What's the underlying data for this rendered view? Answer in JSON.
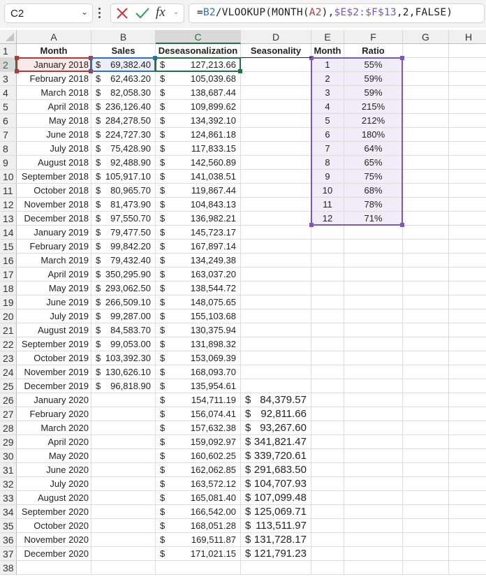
{
  "formula_bar": {
    "name_box": "C2",
    "formula_parts": [
      {
        "text": "=",
        "color": "default"
      },
      {
        "text": "B2",
        "color": "blue"
      },
      {
        "text": "/VLOOKUP(MONTH(",
        "color": "default"
      },
      {
        "text": "A2",
        "color": "red"
      },
      {
        "text": "),",
        "color": "default"
      },
      {
        "text": "$E$2:$F$13",
        "color": "purple"
      },
      {
        "text": ",2,FALSE)",
        "color": "default"
      }
    ],
    "cancel_icon": "x-icon",
    "enter_icon": "check-icon",
    "function_icon": "fx"
  },
  "colors": {
    "accent_green": "#217346",
    "ref_red": "#b03a3a",
    "ref_blue": "#2f6fc4",
    "ref_purple": "#7d56b8"
  },
  "sheet": {
    "active_cell": "C2",
    "columns": [
      "A",
      "B",
      "C",
      "D",
      "E",
      "F",
      "G",
      "H"
    ],
    "headers": {
      "A": "Month",
      "B": "Sales",
      "C": "Deseasonalization",
      "D": "Seasonality",
      "E": "Month",
      "F": "Ratio"
    },
    "rows": [
      {
        "month": "January 2018",
        "sales": "69,382.40",
        "deseason": "127,213.66",
        "seasonality": ""
      },
      {
        "month": "February 2018",
        "sales": "62,463.20",
        "deseason": "105,039.68",
        "seasonality": ""
      },
      {
        "month": "March 2018",
        "sales": "82,058.30",
        "deseason": "138,687.44",
        "seasonality": ""
      },
      {
        "month": "April 2018",
        "sales": "236,126.40",
        "deseason": "109,899.62",
        "seasonality": ""
      },
      {
        "month": "May 2018",
        "sales": "284,278.50",
        "deseason": "134,392.10",
        "seasonality": ""
      },
      {
        "month": "June 2018",
        "sales": "224,727.30",
        "deseason": "124,861.18",
        "seasonality": ""
      },
      {
        "month": "July 2018",
        "sales": "75,428.90",
        "deseason": "117,833.15",
        "seasonality": ""
      },
      {
        "month": "August 2018",
        "sales": "92,488.90",
        "deseason": "142,560.89",
        "seasonality": ""
      },
      {
        "month": "September 2018",
        "sales": "105,917.10",
        "deseason": "141,038.51",
        "seasonality": ""
      },
      {
        "month": "October 2018",
        "sales": "80,965.70",
        "deseason": "119,867.44",
        "seasonality": ""
      },
      {
        "month": "November 2018",
        "sales": "81,473.90",
        "deseason": "104,843.13",
        "seasonality": ""
      },
      {
        "month": "December 2018",
        "sales": "97,550.70",
        "deseason": "136,982.21",
        "seasonality": ""
      },
      {
        "month": "January 2019",
        "sales": "79,477.50",
        "deseason": "145,723.17",
        "seasonality": ""
      },
      {
        "month": "February 2019",
        "sales": "99,842.20",
        "deseason": "167,897.14",
        "seasonality": ""
      },
      {
        "month": "March 2019",
        "sales": "79,432.40",
        "deseason": "134,249.38",
        "seasonality": ""
      },
      {
        "month": "April 2019",
        "sales": "350,295.90",
        "deseason": "163,037.20",
        "seasonality": ""
      },
      {
        "month": "May 2019",
        "sales": "293,062.50",
        "deseason": "138,544.72",
        "seasonality": ""
      },
      {
        "month": "June 2019",
        "sales": "266,509.10",
        "deseason": "148,075.65",
        "seasonality": ""
      },
      {
        "month": "July 2019",
        "sales": "99,287.00",
        "deseason": "155,103.68",
        "seasonality": ""
      },
      {
        "month": "August 2019",
        "sales": "84,583.70",
        "deseason": "130,375.94",
        "seasonality": ""
      },
      {
        "month": "September 2019",
        "sales": "99,053.00",
        "deseason": "131,898.32",
        "seasonality": ""
      },
      {
        "month": "October 2019",
        "sales": "103,392.30",
        "deseason": "153,069.39",
        "seasonality": ""
      },
      {
        "month": "November 2019",
        "sales": "130,626.10",
        "deseason": "168,093.70",
        "seasonality": ""
      },
      {
        "month": "December 2019",
        "sales": "96,818.90",
        "deseason": "135,954.61",
        "seasonality": ""
      },
      {
        "month": "January 2020",
        "sales": "",
        "deseason": "154,711.19",
        "seasonality": "84,379.57"
      },
      {
        "month": "February 2020",
        "sales": "",
        "deseason": "156,074.41",
        "seasonality": "92,811.66"
      },
      {
        "month": "March 2020",
        "sales": "",
        "deseason": "157,632.38",
        "seasonality": "93,267.60"
      },
      {
        "month": "April 2020",
        "sales": "",
        "deseason": "159,092.97",
        "seasonality": "341,821.47"
      },
      {
        "month": "May 2020",
        "sales": "",
        "deseason": "160,602.25",
        "seasonality": "339,720.61"
      },
      {
        "month": "June 2020",
        "sales": "",
        "deseason": "162,062.85",
        "seasonality": "291,683.50"
      },
      {
        "month": "July 2020",
        "sales": "",
        "deseason": "163,572.12",
        "seasonality": "104,707.93"
      },
      {
        "month": "August 2020",
        "sales": "",
        "deseason": "165,081.40",
        "seasonality": "107,099.48"
      },
      {
        "month": "September 2020",
        "sales": "",
        "deseason": "166,542.00",
        "seasonality": "125,069.71"
      },
      {
        "month": "October 2020",
        "sales": "",
        "deseason": "168,051.28",
        "seasonality": "113,511.97"
      },
      {
        "month": "November 2020",
        "sales": "",
        "deseason": "169,511.87",
        "seasonality": "131,728.17"
      },
      {
        "month": "December 2020",
        "sales": "",
        "deseason": "171,021.15",
        "seasonality": "121,791.23"
      }
    ],
    "ratio_table": [
      {
        "month": "1",
        "ratio": "55%"
      },
      {
        "month": "2",
        "ratio": "59%"
      },
      {
        "month": "3",
        "ratio": "59%"
      },
      {
        "month": "4",
        "ratio": "215%"
      },
      {
        "month": "5",
        "ratio": "212%"
      },
      {
        "month": "6",
        "ratio": "180%"
      },
      {
        "month": "7",
        "ratio": "64%"
      },
      {
        "month": "8",
        "ratio": "65%"
      },
      {
        "month": "9",
        "ratio": "75%"
      },
      {
        "month": "10",
        "ratio": "68%"
      },
      {
        "month": "11",
        "ratio": "78%"
      },
      {
        "month": "12",
        "ratio": "71%"
      }
    ],
    "currency_symbol": "$",
    "row_count": 38
  }
}
